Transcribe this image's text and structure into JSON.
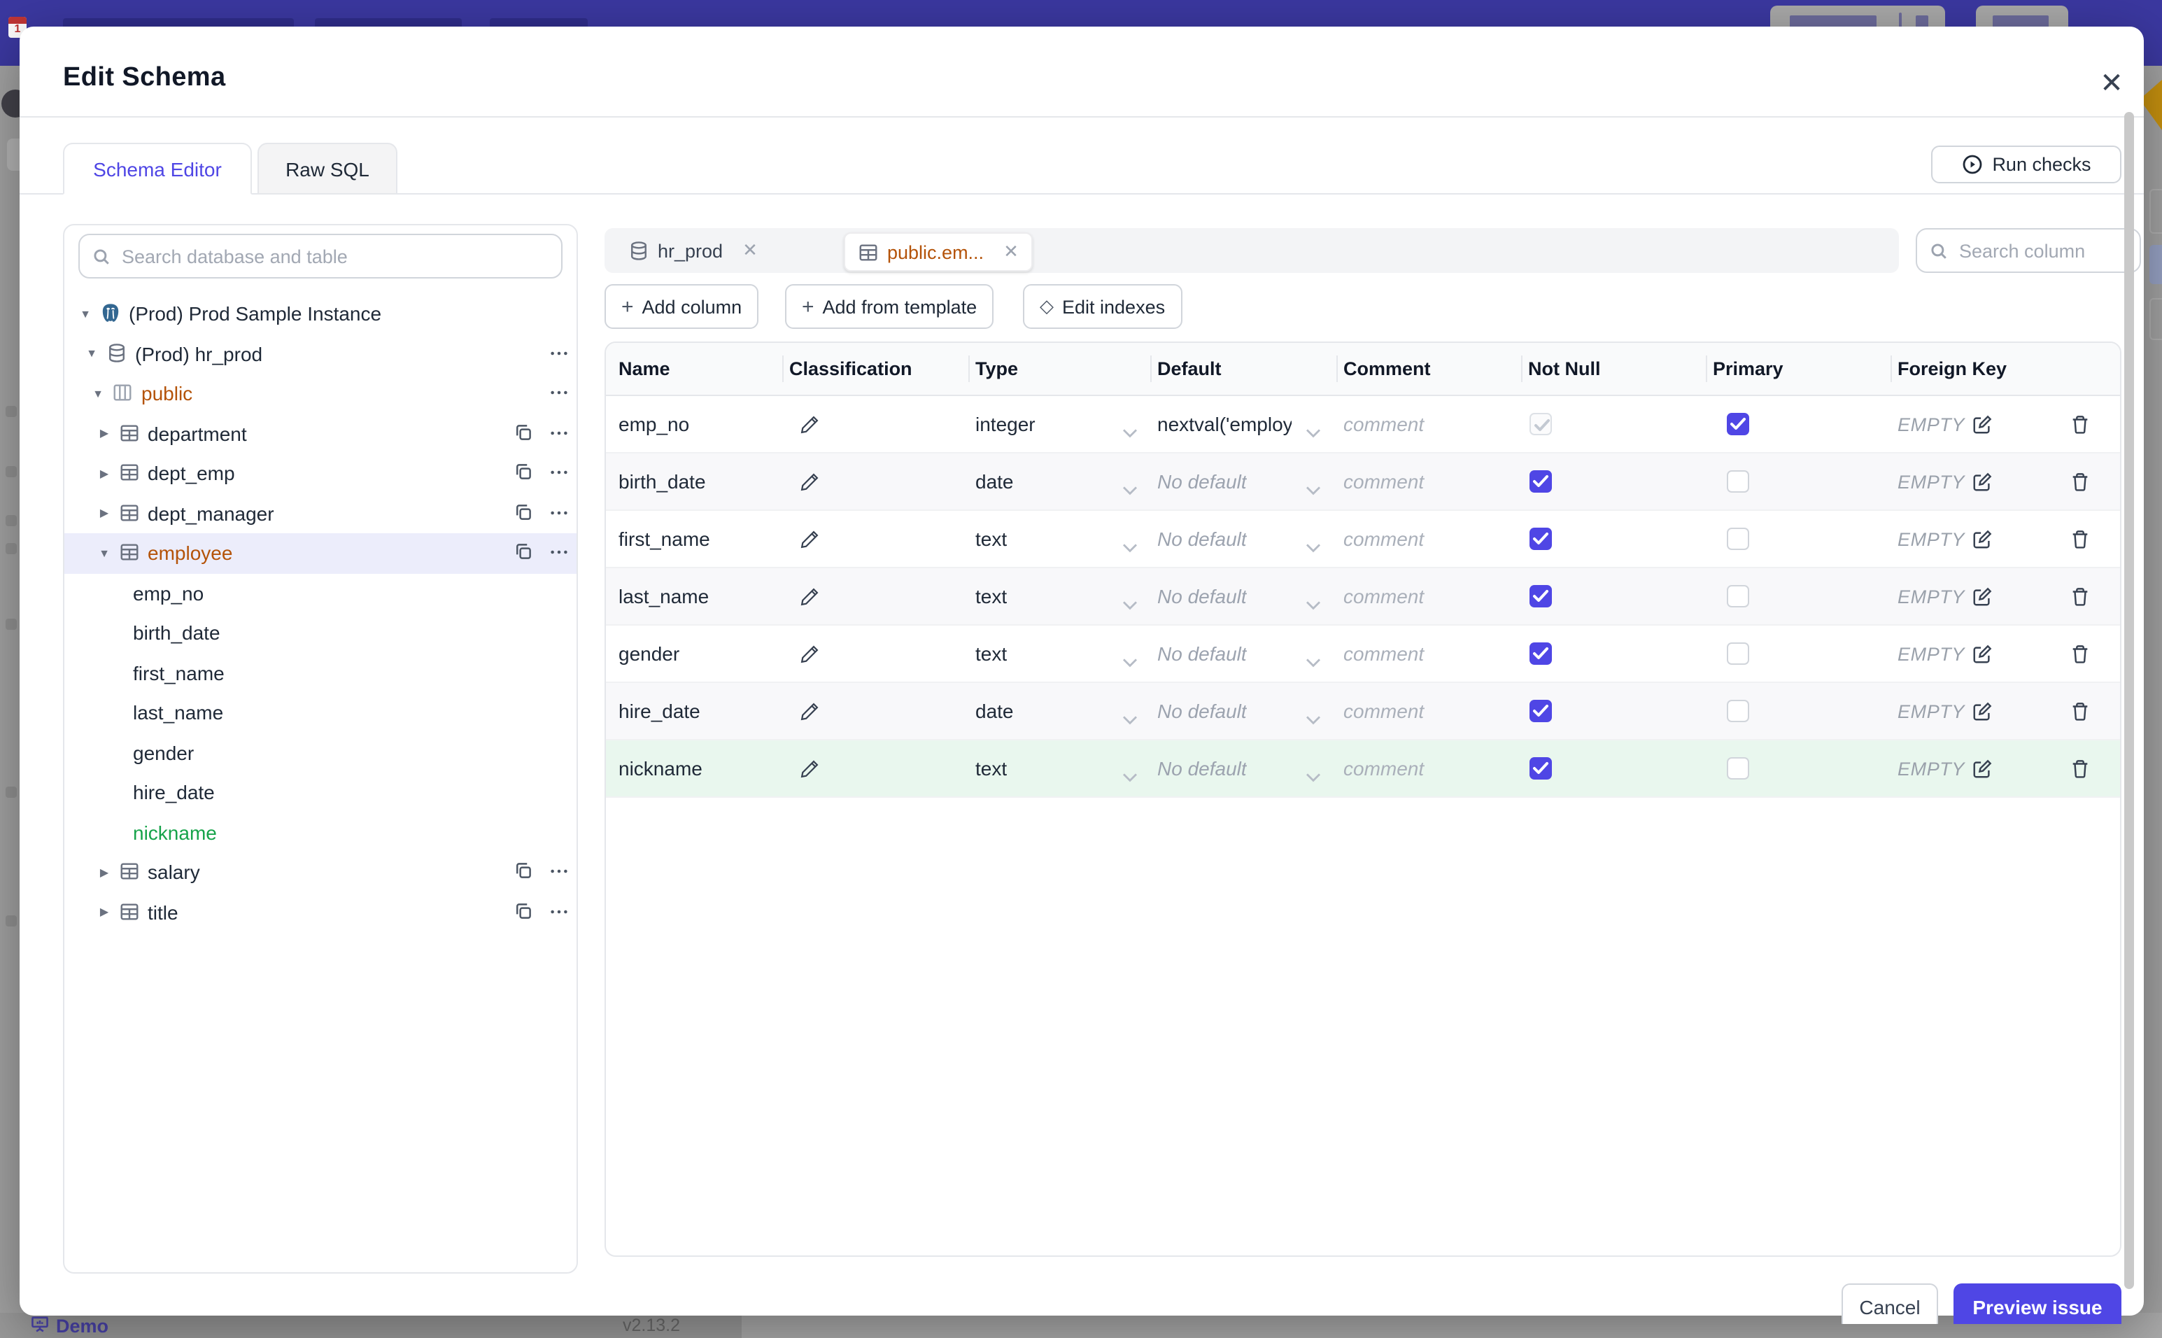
{
  "chrome": {
    "statusbar": {
      "demo_label": "Demo",
      "version": "v2.13.2"
    },
    "favicon_badge": "1"
  },
  "modal": {
    "title": "Edit Schema",
    "tabs": [
      {
        "label": "Schema Editor",
        "active": true
      },
      {
        "label": "Raw SQL",
        "active": false
      }
    ],
    "run_checks_label": "Run checks",
    "footer": {
      "cancel_label": "Cancel",
      "primary_label": "Preview issue"
    }
  },
  "sidebar": {
    "search_placeholder": "Search database and table",
    "tree": [
      {
        "label": "(Prod) Prod Sample Instance",
        "level": 0,
        "caret": "down",
        "icon": "postgres",
        "color": "default",
        "actions": []
      },
      {
        "label": "(Prod) hr_prod",
        "level": 1,
        "caret": "down",
        "icon": "database",
        "color": "default",
        "actions": [
          "menu"
        ]
      },
      {
        "label": "public",
        "level": 2,
        "caret": "down",
        "icon": "schema",
        "color": "amber",
        "actions": [
          "menu"
        ]
      },
      {
        "label": "department",
        "level": 3,
        "caret": "right",
        "icon": "table",
        "color": "default",
        "actions": [
          "copy",
          "menu"
        ]
      },
      {
        "label": "dept_emp",
        "level": 3,
        "caret": "right",
        "icon": "table",
        "color": "default",
        "actions": [
          "copy",
          "menu"
        ]
      },
      {
        "label": "dept_manager",
        "level": 3,
        "caret": "right",
        "icon": "table",
        "color": "default",
        "actions": [
          "copy",
          "menu"
        ]
      },
      {
        "label": "employee",
        "level": 3,
        "caret": "down",
        "icon": "table",
        "color": "amber",
        "selected": true,
        "actions": [
          "copy",
          "menu"
        ]
      },
      {
        "label": "emp_no",
        "level": 4,
        "caret": "none",
        "icon": "none",
        "color": "default",
        "actions": []
      },
      {
        "label": "birth_date",
        "level": 4,
        "caret": "none",
        "icon": "none",
        "color": "default",
        "actions": []
      },
      {
        "label": "first_name",
        "level": 4,
        "caret": "none",
        "icon": "none",
        "color": "default",
        "actions": []
      },
      {
        "label": "last_name",
        "level": 4,
        "caret": "none",
        "icon": "none",
        "color": "default",
        "actions": []
      },
      {
        "label": "gender",
        "level": 4,
        "caret": "none",
        "icon": "none",
        "color": "default",
        "actions": []
      },
      {
        "label": "hire_date",
        "level": 4,
        "caret": "none",
        "icon": "none",
        "color": "default",
        "actions": []
      },
      {
        "label": "nickname",
        "level": 4,
        "caret": "none",
        "icon": "none",
        "color": "green",
        "actions": []
      },
      {
        "label": "salary",
        "level": 3,
        "caret": "right",
        "icon": "table",
        "color": "default",
        "actions": [
          "copy",
          "menu"
        ]
      },
      {
        "label": "title",
        "level": 3,
        "caret": "right",
        "icon": "table",
        "color": "default",
        "actions": [
          "copy",
          "menu"
        ]
      }
    ]
  },
  "editor": {
    "chips": [
      {
        "label": "hr_prod",
        "icon": "database",
        "active": false,
        "color": "default"
      },
      {
        "label": "public.em...",
        "icon": "table",
        "active": true,
        "color": "amber"
      }
    ],
    "toolbar": [
      {
        "label": "Add column",
        "icon": "plus"
      },
      {
        "label": "Add from template",
        "icon": "plus"
      },
      {
        "label": "Edit indexes",
        "icon": "diamond"
      }
    ],
    "column_search_placeholder": "Search column",
    "table": {
      "headers": [
        "Name",
        "Classification",
        "Type",
        "Default",
        "Comment",
        "Not Null",
        "Primary",
        "Foreign Key"
      ],
      "rows": [
        {
          "name": "emp_no",
          "type": "integer",
          "default": "nextval('employ",
          "default_muted": false,
          "comment_placeholder": "comment",
          "not_null_checked": true,
          "not_null_disabled": true,
          "primary_checked": true,
          "foreign_key": "EMPTY",
          "state": "normal"
        },
        {
          "name": "birth_date",
          "type": "date",
          "default": "No default",
          "default_muted": true,
          "comment_placeholder": "comment",
          "not_null_checked": true,
          "not_null_disabled": false,
          "primary_checked": false,
          "foreign_key": "EMPTY",
          "state": "alt"
        },
        {
          "name": "first_name",
          "type": "text",
          "default": "No default",
          "default_muted": true,
          "comment_placeholder": "comment",
          "not_null_checked": true,
          "not_null_disabled": false,
          "primary_checked": false,
          "foreign_key": "EMPTY",
          "state": "normal"
        },
        {
          "name": "last_name",
          "type": "text",
          "default": "No default",
          "default_muted": true,
          "comment_placeholder": "comment",
          "not_null_checked": true,
          "not_null_disabled": false,
          "primary_checked": false,
          "foreign_key": "EMPTY",
          "state": "alt"
        },
        {
          "name": "gender",
          "type": "text",
          "default": "No default",
          "default_muted": true,
          "comment_placeholder": "comment",
          "not_null_checked": true,
          "not_null_disabled": false,
          "primary_checked": false,
          "foreign_key": "EMPTY",
          "state": "normal"
        },
        {
          "name": "hire_date",
          "type": "date",
          "default": "No default",
          "default_muted": true,
          "comment_placeholder": "comment",
          "not_null_checked": true,
          "not_null_disabled": false,
          "primary_checked": false,
          "foreign_key": "EMPTY",
          "state": "alt"
        },
        {
          "name": "nickname",
          "type": "text",
          "default": "No default",
          "default_muted": true,
          "comment_placeholder": "comment",
          "not_null_checked": true,
          "not_null_disabled": false,
          "primary_checked": false,
          "foreign_key": "EMPTY",
          "state": "new"
        }
      ]
    }
  },
  "colors": {
    "accent": "#4f46e5",
    "amber": "#b45309",
    "green": "#16a34a",
    "new_row_bg": "#e9f7ee",
    "topbar": "#3b38a0",
    "backdrop": "#a2a2a2"
  }
}
